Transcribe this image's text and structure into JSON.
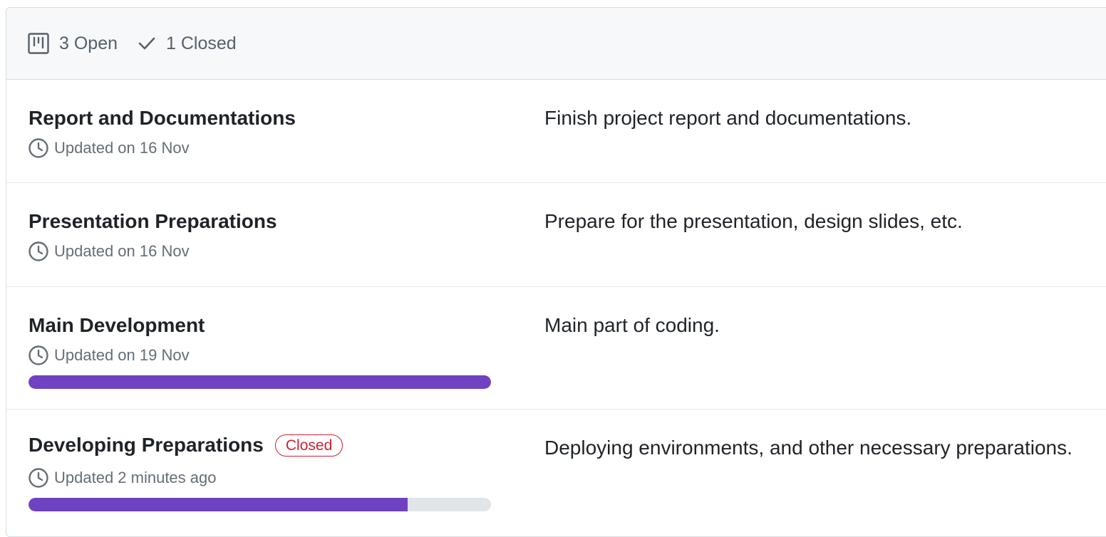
{
  "header": {
    "open_label": "3 Open",
    "closed_label": "1 Closed"
  },
  "milestones": [
    {
      "title": "Report and Documentations",
      "updated": "Updated on 16 Nov",
      "description": "Finish project report and documentations.",
      "badge": null,
      "progress": null
    },
    {
      "title": "Presentation Preparations",
      "updated": "Updated on 16 Nov",
      "description": "Prepare for the presentation, design slides, etc.",
      "badge": null,
      "progress": null
    },
    {
      "title": "Main Development",
      "updated": "Updated on 19 Nov",
      "description": "Main part of coding.",
      "badge": null,
      "progress": 1.0
    },
    {
      "title": "Developing Preparations",
      "updated": "Updated 2 minutes ago",
      "description": "Deploying environments, and other necessary preparations.",
      "badge": "Closed",
      "progress": 0.82
    }
  ],
  "colors": {
    "progress_fill": "#6f42c1",
    "progress_track": "#e1e4e8",
    "closed_badge": "#cf222e"
  },
  "icons": {
    "open": "project-board-icon",
    "closed": "check-icon",
    "updated": "clock-icon"
  }
}
